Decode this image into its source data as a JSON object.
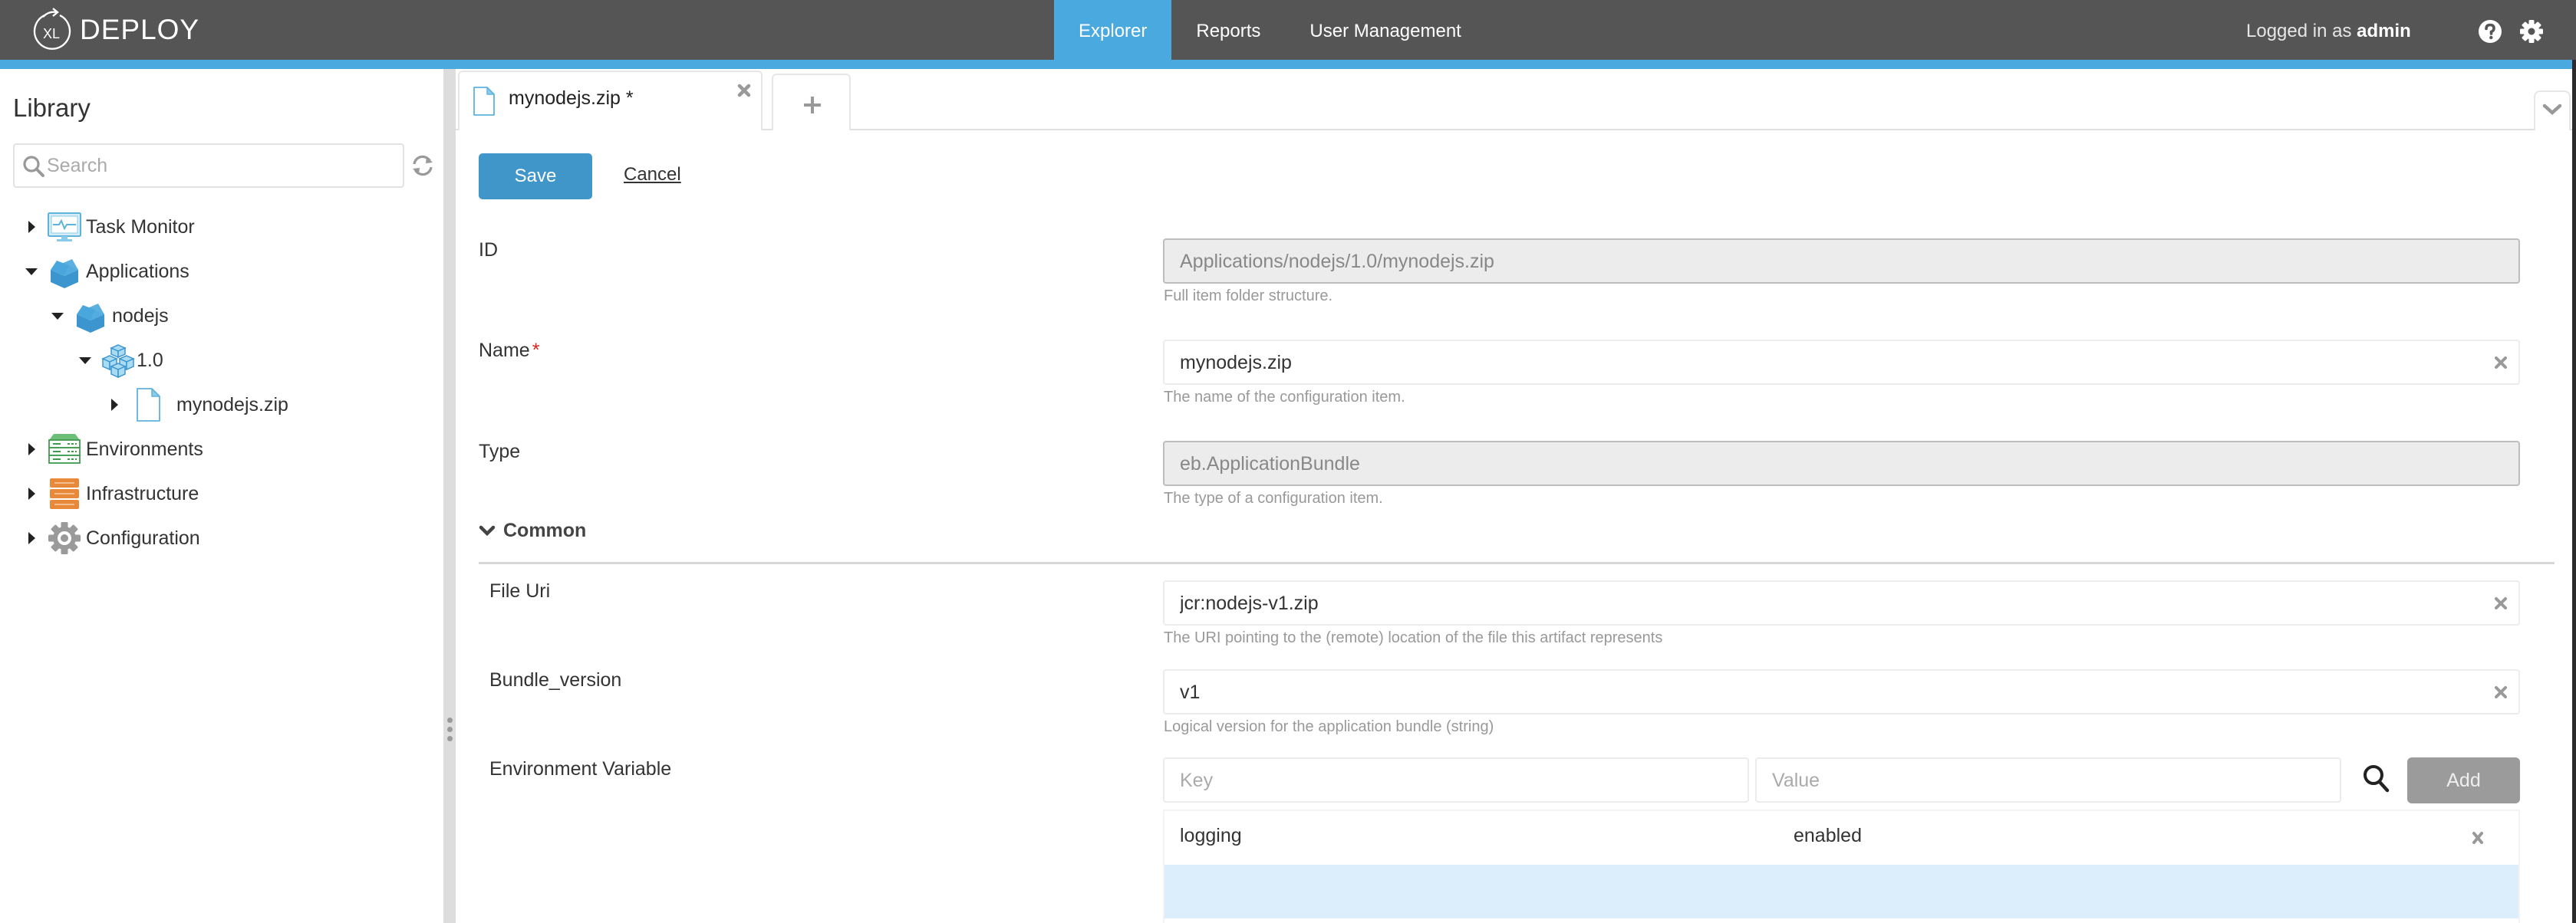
{
  "header": {
    "logo_mark": "XL",
    "logo_text": "DEPLOY",
    "nav": [
      {
        "label": "Explorer",
        "active": true
      },
      {
        "label": "Reports",
        "active": false
      },
      {
        "label": "User Management",
        "active": false
      }
    ],
    "logged_in_prefix": "Logged in as",
    "username": "admin",
    "icons": [
      "help-icon",
      "settings-gear-icon"
    ],
    "accent_color": "#4aaae0",
    "bar_color": "#555555"
  },
  "sidebar": {
    "title": "Library",
    "search_placeholder": "Search",
    "tree": [
      {
        "label": "Task Monitor",
        "icon": "task-monitor-icon",
        "level": 0,
        "expanded": false
      },
      {
        "label": "Applications",
        "icon": "applications-icon",
        "level": 0,
        "expanded": true
      },
      {
        "label": "nodejs",
        "icon": "application-icon",
        "level": 1,
        "expanded": true
      },
      {
        "label": "1.0",
        "icon": "deployment-package-icon",
        "level": 2,
        "expanded": true
      },
      {
        "label": "mynodejs.zip",
        "icon": "file-icon",
        "level": 3,
        "expanded": false
      },
      {
        "label": "Environments",
        "icon": "environments-icon",
        "level": 0,
        "expanded": false
      },
      {
        "label": "Infrastructure",
        "icon": "infrastructure-icon",
        "level": 0,
        "expanded": false
      },
      {
        "label": "Configuration",
        "icon": "configuration-gear-icon",
        "level": 0,
        "expanded": false
      }
    ]
  },
  "tabs": {
    "open": [
      {
        "label": "mynodejs.zip *",
        "icon": "file-icon",
        "modified": true
      }
    ],
    "add_label": "+"
  },
  "form": {
    "save_label": "Save",
    "cancel_label": "Cancel",
    "fields": {
      "id": {
        "label": "ID",
        "value": "Applications/nodejs/1.0/mynodejs.zip",
        "help": "Full item folder structure.",
        "readonly": true
      },
      "name": {
        "label": "Name",
        "required_mark": "*",
        "value": "mynodejs.zip",
        "help": "The name of the configuration item.",
        "readonly": false
      },
      "type": {
        "label": "Type",
        "value": "eb.ApplicationBundle",
        "help": "The type of a configuration item.",
        "readonly": true
      }
    },
    "section": {
      "title": "Common",
      "expanded": true,
      "fields": {
        "file_uri": {
          "label": "File Uri",
          "value": "jcr:nodejs-v1.zip",
          "help": "The URI pointing to the (remote) location of the file this artifact represents"
        },
        "bundle_version": {
          "label": "Bundle_version",
          "value": "v1",
          "help": "Logical version for the application bundle (string)"
        },
        "env_var": {
          "label": "Environment Variable",
          "key_placeholder": "Key",
          "value_placeholder": "Value",
          "add_label": "Add",
          "entries": [
            {
              "key": "logging",
              "value": "enabled"
            }
          ]
        }
      }
    }
  }
}
